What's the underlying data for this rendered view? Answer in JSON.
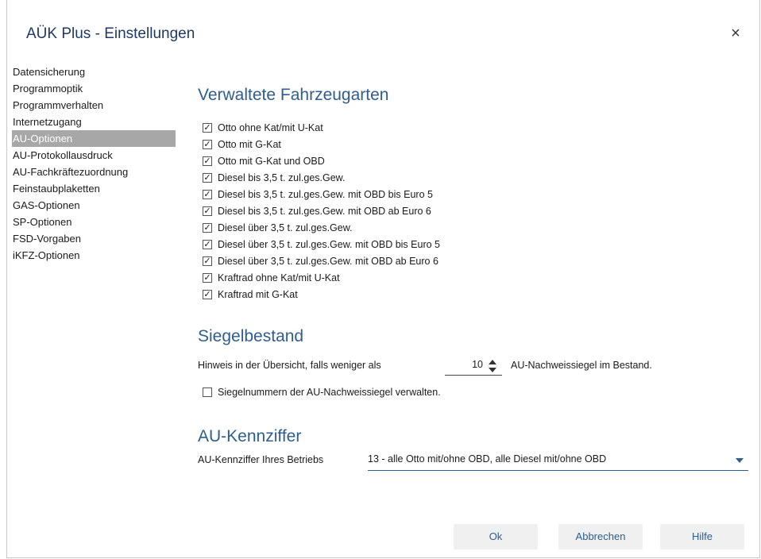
{
  "window": {
    "title": "AÜK Plus - Einstellungen",
    "close_glyph": "×"
  },
  "sidebar": {
    "items": [
      {
        "label": "Datensicherung"
      },
      {
        "label": "Programmoptik"
      },
      {
        "label": "Programmverhalten"
      },
      {
        "label": "Internetzugang"
      },
      {
        "label": "AU-Optionen",
        "selected": true
      },
      {
        "label": "AU-Protokollausdruck"
      },
      {
        "label": "AU-Fachkräftezuordnung"
      },
      {
        "label": "Feinstaubplaketten"
      },
      {
        "label": "GAS-Optionen"
      },
      {
        "label": "SP-Optionen"
      },
      {
        "label": "FSD-Vorgaben"
      },
      {
        "label": "iKFZ-Optionen"
      }
    ]
  },
  "vehicle_types": {
    "heading": "Verwaltete Fahrzeugarten",
    "items": [
      {
        "label": "Otto ohne Kat/mit U-Kat",
        "checked": true
      },
      {
        "label": "Otto mit G-Kat",
        "checked": true
      },
      {
        "label": "Otto mit G-Kat und OBD",
        "checked": true
      },
      {
        "label": "Diesel bis 3,5 t. zul.ges.Gew.",
        "checked": true
      },
      {
        "label": "Diesel bis 3,5 t. zul.ges.Gew. mit OBD bis Euro 5",
        "checked": true
      },
      {
        "label": "Diesel bis 3,5 t. zul.ges.Gew. mit OBD ab Euro 6",
        "checked": true
      },
      {
        "label": "Diesel über 3,5 t. zul.ges.Gew.",
        "checked": true
      },
      {
        "label": "Diesel über 3,5 t. zul.ges.Gew. mit OBD bis Euro 5",
        "checked": true
      },
      {
        "label": "Diesel über 3,5 t. zul.ges.Gew. mit OBD ab Euro 6",
        "checked": true
      },
      {
        "label": "Kraftrad ohne Kat/mit U-Kat",
        "checked": true
      },
      {
        "label": "Kraftrad mit G-Kat",
        "checked": true
      }
    ]
  },
  "seal_stock": {
    "heading": "Siegelbestand",
    "hint_label": "Hinweis in der Übersicht, falls weniger als",
    "threshold_value": "10",
    "suffix_label": "AU-Nachweissiegel im Bestand.",
    "manage_label": "Siegelnummern der AU-Nachweissiegel verwalten.",
    "manage_checked": false
  },
  "au_code": {
    "heading": "AU-Kennziffer",
    "label": "AU-Kennziffer Ihres Betriebs",
    "selected": "13 - alle Otto mit/ohne OBD, alle Diesel mit/ohne OBD"
  },
  "buttons": {
    "ok": "Ok",
    "cancel": "Abbrechen",
    "help": "Hilfe"
  },
  "colors": {
    "heading": "#2e5d8f",
    "title": "#1f3864",
    "selection": "#a7a7a7"
  }
}
